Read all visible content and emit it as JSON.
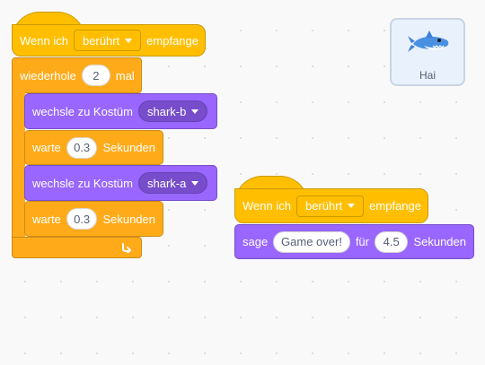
{
  "sprite": {
    "name": "Hai",
    "icon": "shark-icon"
  },
  "script1": {
    "hat": {
      "prefix": "Wenn ich",
      "dropdown": "berührt",
      "suffix": "empfange"
    },
    "repeat": {
      "prefix": "wiederhole",
      "count": "2",
      "suffix": "mal"
    },
    "body": [
      {
        "type": "costume",
        "prefix": "wechsle zu Kostüm",
        "value": "shark-b"
      },
      {
        "type": "wait",
        "prefix": "warte",
        "value": "0.3",
        "suffix": "Sekunden"
      },
      {
        "type": "costume",
        "prefix": "wechsle zu Kostüm",
        "value": "shark-a"
      },
      {
        "type": "wait",
        "prefix": "warte",
        "value": "0.3",
        "suffix": "Sekunden"
      }
    ]
  },
  "script2": {
    "hat": {
      "prefix": "Wenn ich",
      "dropdown": "berührt",
      "suffix": "empfange"
    },
    "say": {
      "prefix": "sage",
      "message": "Game over!",
      "middle": "für",
      "seconds": "4.5",
      "suffix": "Sekunden"
    }
  },
  "colors": {
    "events": "#ffbf00",
    "control": "#ffab19",
    "looks": "#9966ff",
    "background": "#f9f9f9"
  }
}
